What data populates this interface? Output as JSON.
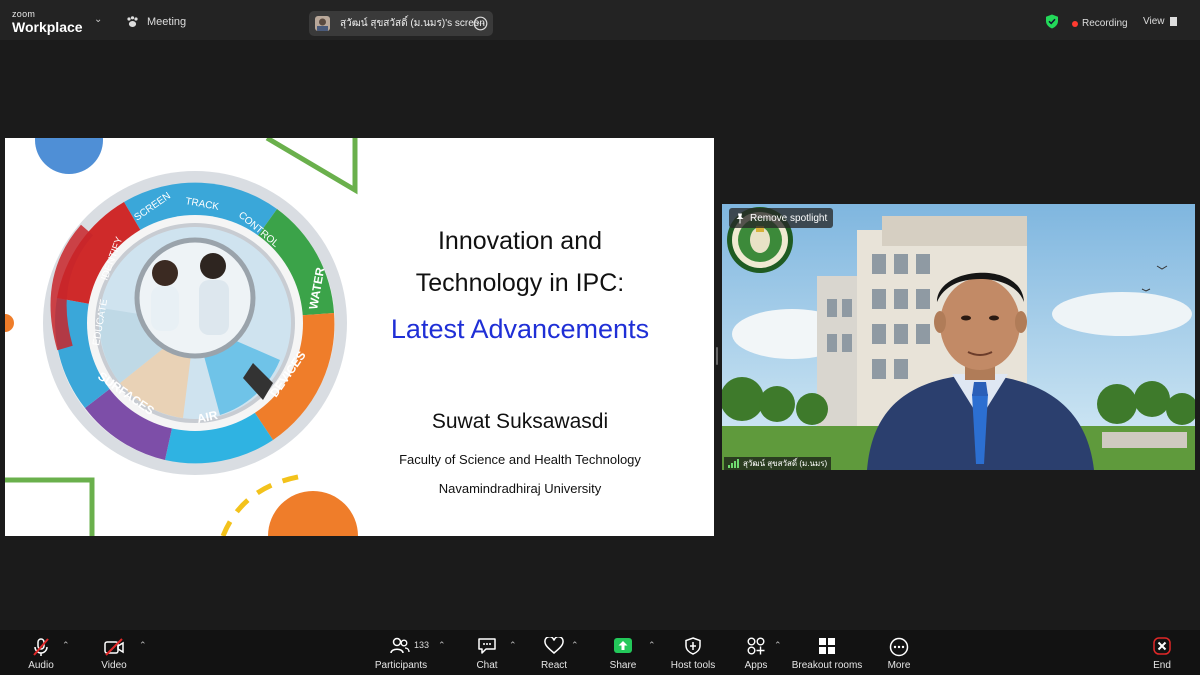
{
  "app": {
    "brand_top": "zoom",
    "brand_bottom": "Workplace",
    "meeting_label": "Meeting",
    "share_label": "สุวัฒน์ สุขสวัสดิ์ (ม.นมร)'s screen",
    "recording_label": "Recording",
    "view_label": "View",
    "accent_color": "#23d959",
    "recording_color": "#ff3b30"
  },
  "slide": {
    "title_line1": "Innovation and",
    "title_line2": "Technology in IPC:",
    "title_line3": "Latest Advancements",
    "presenter": "Suwat Suksawasdi",
    "affiliation1": "Faculty of Science and Health Technology",
    "affiliation2": "Navamindradhiraj University",
    "wheel_labels": [
      "IDENTIFY",
      "SCREEN",
      "TRACK",
      "CONTROL",
      "WATER",
      "DEVICES",
      "AIR",
      "SURFACES",
      "EDUCATE"
    ],
    "title_accent_color": "#1f2fd6"
  },
  "video": {
    "spotlight_label": "Remove spotlight",
    "participant_name": "สุวัฒน์ สุขสวัสดิ์ (ม.นมร)"
  },
  "toolbar": {
    "audio": "Audio",
    "video": "Video",
    "participants": "Participants",
    "participants_count": "133",
    "chat": "Chat",
    "react": "React",
    "share": "Share",
    "host_tools": "Host tools",
    "apps": "Apps",
    "breakout_rooms": "Breakout rooms",
    "more": "More",
    "end": "End",
    "end_color": "#e02828",
    "share_color": "#23c85a"
  }
}
